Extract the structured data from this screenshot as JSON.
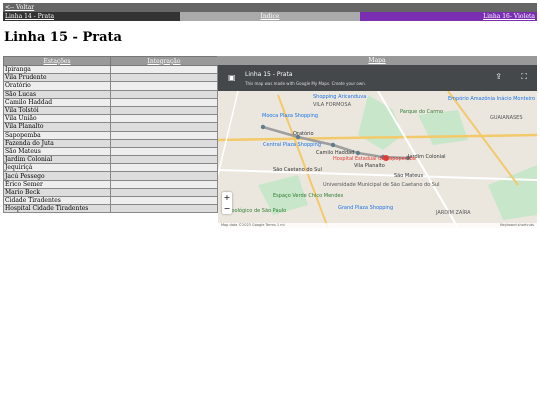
{
  "top": {
    "back_label": "<-- Voltar"
  },
  "nav": {
    "prev_label": "Linha 14 - Prata",
    "index_label": "Índice",
    "next_label": "Linha 16- Violeta"
  },
  "page_title": "Linha 15 - Prata",
  "table": {
    "headers": [
      "Estações",
      "Integração"
    ],
    "rows": [
      "Ipiranga",
      "Vila Prudente",
      "Oratório",
      "São Lucas",
      "Camilo Haddad",
      "Vila Tolstói",
      "Vila União",
      "Vila Planalto",
      "Sapopemba",
      "Fazenda do Juta",
      "São Mateus",
      "Jardim Colonial",
      "Jequiriçá",
      "Jacú Pessego",
      "Érico Semer",
      "Mario Beck",
      "Cidade Tiradentes",
      "Hospital Cidade Tiradentes"
    ]
  },
  "map": {
    "header": "Mapa",
    "title": "Linha 15 - Prata",
    "subtitle": "This map was made with Google My Maps. Create your own.",
    "footer": "Map data ©2023 Google   Terms   1 mi",
    "shortcuts": "Keyboard shortcuts",
    "place_labels": {
      "p1": "VILA FORMOSA",
      "p2": "Shopping Aricanduva",
      "p3": "Mooca Plaza Shopping",
      "p4": "Parque do Carmo",
      "p5": "GUAIANASES",
      "p6": "Oratório",
      "p7": "Camilo Haddad",
      "p8": "Vila Planalto",
      "p9": "São Mateus",
      "p10": "Jardim Colonial",
      "p11": "São Caetano do Sul",
      "p12": "Espaço Verde Chico Mendes",
      "p13": "Grand Plaza Shopping",
      "p14": "JARDIM ZAÍRA",
      "p15": "Central Plaza Shopping",
      "p16": "Zoológico de São Paulo",
      "p17": "Empório Amazônia Inácio Monteiro",
      "p18": "Hospital Estadual de Sapopemba",
      "p19": "Universidade Municipal de São Caetano do Sul"
    }
  }
}
